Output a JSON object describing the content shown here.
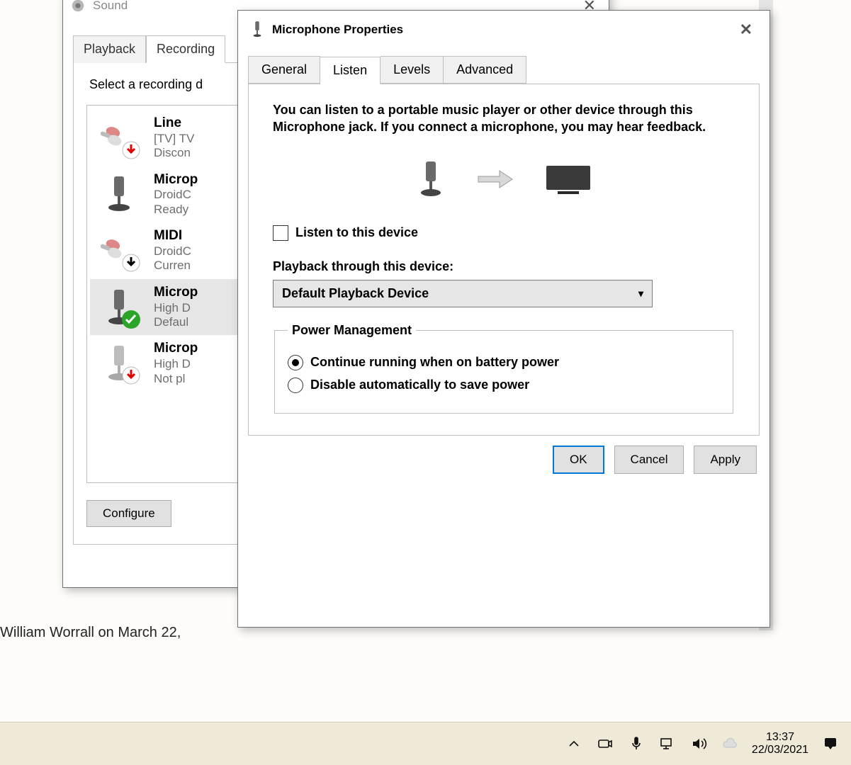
{
  "article_byline": "William Worrall on March 22,",
  "sound_window": {
    "title": "Sound",
    "tabs": [
      "Playback",
      "Recording"
    ],
    "active_tab": 1,
    "instruction": "Select a recording d",
    "devices": [
      {
        "name": "Line",
        "line2": "[TV] TV",
        "line3": "Discon",
        "badge": "down-red"
      },
      {
        "name": "Microp",
        "line2": "DroidC",
        "line3": "Ready",
        "badge": "none"
      },
      {
        "name": "MIDI",
        "line2": "DroidC",
        "line3": "Curren",
        "badge": "down-black"
      },
      {
        "name": "Microp",
        "line2": "High D",
        "line3": "Defaul",
        "badge": "check-green",
        "selected": true
      },
      {
        "name": "Microp",
        "line2": "High D",
        "line3": "Not pl",
        "badge": "down-red",
        "dim": true
      }
    ],
    "configure_label": "Configure"
  },
  "prop_window": {
    "title": "Microphone Properties",
    "tabs": [
      "General",
      "Listen",
      "Levels",
      "Advanced"
    ],
    "active_tab": 1,
    "desc": "You can listen to a portable music player or other device through this Microphone jack. If you connect a microphone, you may hear feedback.",
    "listen_checkbox_label": "Listen to this device",
    "listen_checked": false,
    "playback_label": "Playback through this device:",
    "playback_selected": "Default Playback Device",
    "power_legend": "Power Management",
    "radio_continue": "Continue running when on battery power",
    "radio_disable": "Disable automatically to save power",
    "radio_selected": 0,
    "ok": "OK",
    "cancel": "Cancel",
    "apply": "Apply"
  },
  "taskbar": {
    "time": "13:37",
    "date": "22/03/2021"
  }
}
